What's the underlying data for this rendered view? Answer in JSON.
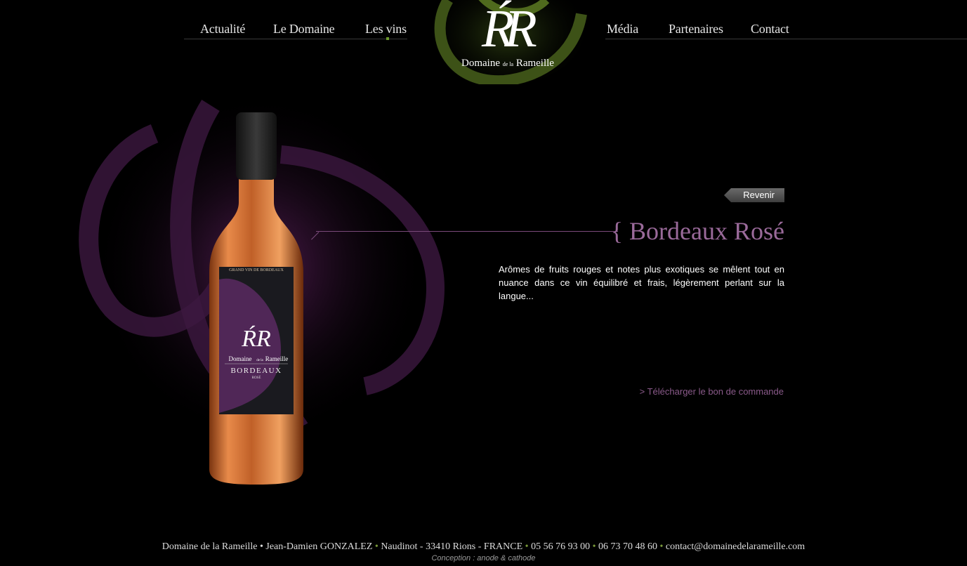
{
  "nav": {
    "left": [
      "Actualité",
      "Le Domaine",
      "Les vins"
    ],
    "right": [
      "Média",
      "Partenaires",
      "Contact"
    ],
    "active": "Les vins"
  },
  "logo": {
    "monogram": "ŔR",
    "name_a": "Domaine",
    "name_b": "de la",
    "name_c": "Rameille"
  },
  "bottle_label": {
    "top": "GRAND VIN DE BORDEAUX",
    "monogram": "ŔR",
    "name_a": "Domaine",
    "name_b": "de la",
    "name_c": "Rameille",
    "appellation": "BORDEAUX",
    "color": "ROSÉ"
  },
  "content": {
    "back_label": "Revenir",
    "title": "{ Bordeaux Rosé",
    "description": "Arômes de fruits rouges et notes plus exotiques se mêlent tout en nuance dans ce vin équilibré et frais, légèrement perlant sur la langue...",
    "download_link": "> Télécharger le bon de commande"
  },
  "footer": {
    "company": "Domaine de la Rameille",
    "owner": "Jean-Damien GONZALEZ",
    "address": "Naudinot - 33410 Rions - FRANCE",
    "phone1": "05 56 76 93 00",
    "phone2": "06 73 70 48 60",
    "email": "contact@domainedelarameille.com",
    "credits": "Conception : anode & cathode"
  },
  "colors": {
    "accent_purple": "#9a6a9a",
    "accent_green": "#6c9a2a",
    "background": "#000000"
  }
}
